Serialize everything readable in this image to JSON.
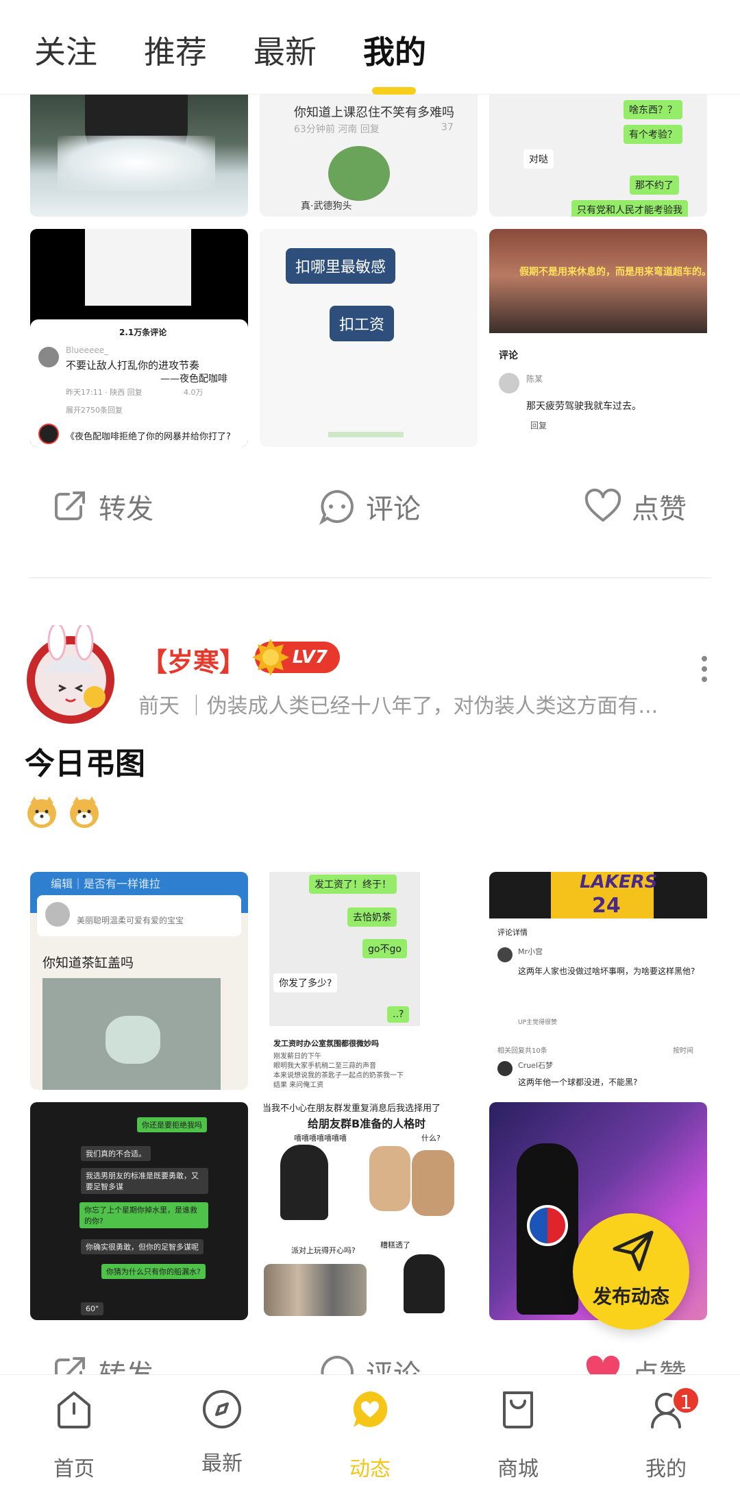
{
  "top_tabs": [
    {
      "label": "关注"
    },
    {
      "label": "推荐"
    },
    {
      "label": "最新"
    },
    {
      "label": "我的"
    }
  ],
  "post1": {
    "thumb_texts": {
      "t2_line": "你知道上课忍住不笑有多难吗",
      "t2_meta": "63分钟前  河南  回复",
      "t2_likes": "37",
      "t2_caption": "真·武德狗头",
      "t3_bubble1": "啥东西？？",
      "t3_bubble2": "有个考验？",
      "t3_bubble3": "对哒",
      "t3_bubble4": "那不约了",
      "t3_bubble5": "只有党和人民才能考验我",
      "t4_comments": "2.1万条评论",
      "t4_user": "Blueeeee_",
      "t4_text1": "不要让敌人打乱你的进攻节奏",
      "t4_text2": "——夜色配咖啡",
      "t4_meta": "昨天17:11 · 陕西   回复",
      "t4_likes": "4.0万",
      "t4_expand": "展开2750条回复",
      "t4_bottom": "《夜色配咖啡拒绝了你的网暴并给你打了?",
      "t5_bubble1": "扣哪里最敏感",
      "t5_bubble2": "扣工资",
      "t6_banner": "假期不是用来休息的，而是用来弯道超车的。",
      "t6_comment_label": "评论",
      "t6_user": "陈某",
      "t6_text": "那天疲劳驾驶我就车过去。",
      "t6_reply": "回复"
    },
    "actions": {
      "share": "转发",
      "comment": "评论",
      "like": "点赞"
    }
  },
  "post2": {
    "username": "【岁寒】",
    "level": "LV7",
    "meta": "前天 ｜伪装成人类已经十八年了，对伪装人类这方面有...",
    "title": "今日弔图",
    "thumb_texts": {
      "t1_top": "编辑｜是否有一样谁拉",
      "t1_sub": "美丽聪明温柔可爱有爱的宝宝",
      "t1_q": "你知道茶缸盖吗",
      "t2_b1": "发工资了！终于！",
      "t2_b2": "去恰奶茶",
      "t2_b3": "go不go",
      "t2_b4": "你发了多少?",
      "t2_b5": "..?",
      "t2_cap1": "发工资时办公室氛围都很微妙吗",
      "t2_cap2": "刚发薪日的下午",
      "t2_cap3": "眼明我大家手机稍二至三蒜的声音",
      "t2_cap4": "本来说想说我的茶匙子一起点的奶茶我一下",
      "t2_cap5": "结果 来问俺工资",
      "t3_jersey": "LAKERS",
      "t3_num": "24",
      "t3_title": "评论详情",
      "t3_user": "Mr小宫",
      "t3_text": "这两年人家也没做过啥坏事啊，为啥要这样黑他?",
      "t3_reply_meta": "UP主觉得很赞",
      "t3_count": "相关回复共10条",
      "t3_sort": "按时间",
      "t3_user2": "Cruel石梦",
      "t3_text2": "这两年他一个球都没进，不能黑?",
      "t4_b1": "你还是要拒绝我吗",
      "t4_b2": "我们真的不合适。",
      "t4_b3": "我选男朋友的标准是既要勇敢，又要足智多谋",
      "t4_b4": "你忘了上个星期你掉水里，是谁救的你?",
      "t4_b5": "你确实很勇敢，但你的足智多谋呢",
      "t4_b6": "你猜为什么只有你的船漏水?",
      "t4_voice": "60\"",
      "t5_top": "当我不小心在朋友群发重复消息后我选择用了",
      "t5_title": "给朋友群B准备的人格时",
      "t5_sound": "嘻嘻嘻嘻嘻嘻嘻",
      "t5_q": "什么?",
      "t5_q2": "派对上玩得开心吗?",
      "t5_bad": "糟糕透了"
    },
    "actions": {
      "share": "转发",
      "comment": "评论",
      "like": "点赞"
    }
  },
  "fab": {
    "label": "发布动态"
  },
  "bottom_nav": [
    {
      "label": "首页",
      "icon": "home-icon"
    },
    {
      "label": "最新",
      "icon": "compass-icon"
    },
    {
      "label": "动态",
      "icon": "heart-bubble-icon"
    },
    {
      "label": "商城",
      "icon": "bag-icon"
    },
    {
      "label": "我的",
      "icon": "user-icon"
    }
  ],
  "badge_count": "1",
  "colors": {
    "accent": "#f7cf1b",
    "red": "#e8382b",
    "text_gray": "#777777"
  }
}
